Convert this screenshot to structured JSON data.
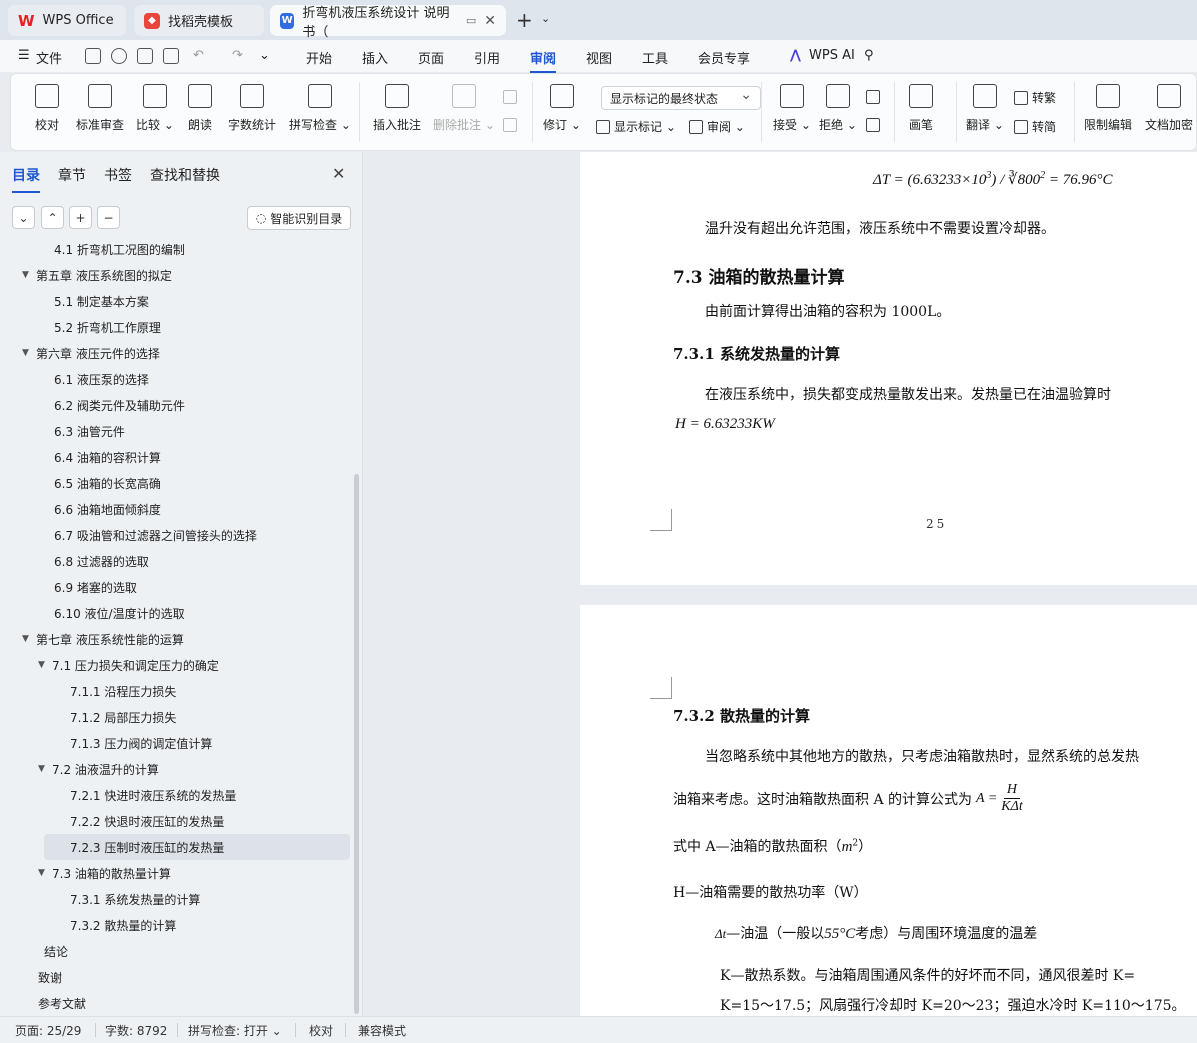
{
  "tabs": {
    "wps": "WPS Office",
    "template": "找稻壳模板",
    "doc": "折弯机液压系统设计 说明书（"
  },
  "menu": {
    "file": "文件",
    "items": [
      "开始",
      "插入",
      "页面",
      "引用",
      "审阅",
      "视图",
      "工具",
      "会员专享"
    ],
    "ai": "WPS AI"
  },
  "ribbon": {
    "proofread": "校对",
    "standard_review": "标准审查",
    "compare": "比较",
    "read_aloud": "朗读",
    "word_count": "字数统计",
    "spell_check": "拼写检查",
    "insert_comment": "插入批注",
    "delete_comment": "删除批注",
    "revise": "修订",
    "markup_state": "显示标记的最终状态",
    "show_markup": "显示标记",
    "review": "审阅",
    "accept": "接受",
    "reject": "拒绝",
    "pen": "画笔",
    "translate": "翻译",
    "to_traditional": "转繁",
    "to_simplified": "转简",
    "restrict_edit": "限制编辑",
    "doc_encrypt": "文档加密"
  },
  "sidebar": {
    "tabs": [
      "目录",
      "章节",
      "书签",
      "查找和替换"
    ],
    "smart_toc": "智能识别目录",
    "toc": [
      {
        "text": "4.1 折弯机工况图的编制",
        "level": 2
      },
      {
        "text": "第五章  液压系统图的拟定",
        "level": 1,
        "arrow": true
      },
      {
        "text": "5.1  制定基本方案",
        "level": 2
      },
      {
        "text": "5.2 折弯机工作原理",
        "level": 2
      },
      {
        "text": "第六章  液压元件的选择",
        "level": 1,
        "arrow": true
      },
      {
        "text": "6.1  液压泵的选择",
        "level": 2
      },
      {
        "text": "6.2    阀类元件及辅助元件",
        "level": 2
      },
      {
        "text": "6.3  油管元件",
        "level": 2
      },
      {
        "text": "6.4 油箱的容积计算",
        "level": 2
      },
      {
        "text": "6.5 油箱的长宽高确",
        "level": 2
      },
      {
        "text": "6.6 油箱地面倾斜度",
        "level": 2
      },
      {
        "text": "6.7 吸油管和过滤器之间管接头的选择",
        "level": 2
      },
      {
        "text": "6.8 过滤器的选取",
        "level": 2
      },
      {
        "text": "6.9 堵塞的选取",
        "level": 2
      },
      {
        "text": "6.10 液位/温度计的选取",
        "level": 2
      },
      {
        "text": "第七章    液压系统性能的运算",
        "level": 1,
        "arrow": true
      },
      {
        "text": "7.1    压力损失和调定压力的确定",
        "level": 2,
        "arrow": true
      },
      {
        "text": "7.1.1 沿程压力损失",
        "level": 3
      },
      {
        "text": "7.1.2 局部压力损失",
        "level": 3
      },
      {
        "text": "7.1.3 压力阀的调定值计算",
        "level": 3
      },
      {
        "text": "7.2  油液温升的计算",
        "level": 2,
        "arrow": true
      },
      {
        "text": "7.2.1 快进时液压系统的发热量",
        "level": 3
      },
      {
        "text": "7.2.2  快退时液压缸的发热量",
        "level": 3
      },
      {
        "text": "7.2.3 压制时液压缸的发热量",
        "level": 3,
        "selected": true
      },
      {
        "text": "7.3 油箱的散热量计算",
        "level": 2,
        "arrow": true
      },
      {
        "text": "7.3.1 系统发热量的计算",
        "level": 3
      },
      {
        "text": "7.3.2  散热量的计算",
        "level": 3
      },
      {
        "text": "结论",
        "level": 0
      },
      {
        "text": "致谢",
        "level": 1
      },
      {
        "text": "参考文献",
        "level": 1
      }
    ]
  },
  "doc": {
    "formula_dt_lhs": "ΔT = (6.63233×10",
    "formula_dt_exp": "3",
    "formula_dt_mid": ") / ∛800",
    "formula_dt_sq": "2",
    "formula_dt_rhs": " = 76.96°C",
    "para1": "温升没有超出允许范围，液压系统中不需要设置冷却器。",
    "h_73": "7.3 油箱的散热量计算",
    "para2": "由前面计算得出油箱的容积为 1000L。",
    "h_731": "7.3.1 系统发热量的计算",
    "para3": "在液压系统中，损失都变成热量散发出来。发热量已在油温验算时",
    "formula_h": "H = 6.63233KW",
    "page_number": "25",
    "h_732": "7.3.2  散热量的计算",
    "para4": "当忽略系统中其他地方的散热，只考虑油箱散热时，显然系统的总发热",
    "para5": "油箱来考虑。这时油箱散热面积 A 的计算公式为",
    "formula_a_lhs": "A =",
    "formula_a_num": "H",
    "formula_a_den": "KΔt",
    "para6": "式中   A—油箱的散热面积（",
    "para6_unit": "m",
    "para6_exp": "2",
    "para6_end": "）",
    "para7": "H—油箱需要的散热功率（W）",
    "para8_sym": "Δt",
    "para8a": "—油温（一般以",
    "para8_temp": "55°C",
    "para8b": "考虑）与周围环境温度的温差",
    "para9": "K—散热系数。与油箱周围通风条件的好坏而不同，通风很差时 K=",
    "para10": "K=15～17.5；风扇强行冷却时 K=20～23；强迫水冷时 K=110～175。"
  },
  "status": {
    "page": "页面: 25/29",
    "words": "字数: 8792",
    "spell": "拼写检查: 打开",
    "proof": "校对",
    "compat": "兼容模式"
  }
}
